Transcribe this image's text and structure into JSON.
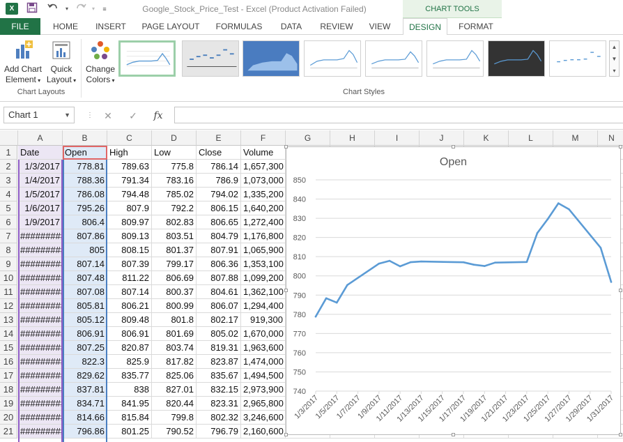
{
  "window": {
    "title": "Google_Stock_Price_Test - Excel (Product Activation Failed)",
    "app_icon": "X",
    "contextual_band": "CHART TOOLS"
  },
  "tabs": [
    "FILE",
    "HOME",
    "INSERT",
    "PAGE LAYOUT",
    "FORMULAS",
    "DATA",
    "REVIEW",
    "VIEW",
    "DESIGN",
    "FORMAT"
  ],
  "active_tab": "DESIGN",
  "ribbon": {
    "add_chart_line1": "Add Chart",
    "add_chart_line2": "Element",
    "quick_line1": "Quick",
    "quick_line2": "Layout",
    "change_line1": "Change",
    "change_line2": "Colors",
    "group_chart_layouts": "Chart Layouts",
    "group_chart_styles": "Chart Styles"
  },
  "formula_bar": {
    "name_box": "Chart 1",
    "cancel_icon": "✕",
    "enter_icon": "✓",
    "fx_label": "fx",
    "value": ""
  },
  "columns": [
    "A",
    "B",
    "C",
    "D",
    "E",
    "F",
    "G",
    "H",
    "I",
    "J",
    "K",
    "L",
    "M",
    "N"
  ],
  "rows": [
    [
      "Date",
      "Open",
      "High",
      "Low",
      "Close",
      "Volume"
    ],
    [
      "1/3/2017",
      "778.81",
      "789.63",
      "775.8",
      "786.14",
      "1,657,300"
    ],
    [
      "1/4/2017",
      "788.36",
      "791.34",
      "783.16",
      "786.9",
      "1,073,000"
    ],
    [
      "1/5/2017",
      "786.08",
      "794.48",
      "785.02",
      "794.02",
      "1,335,200"
    ],
    [
      "1/6/2017",
      "795.26",
      "807.9",
      "792.2",
      "806.15",
      "1,640,200"
    ],
    [
      "1/9/2017",
      "806.4",
      "809.97",
      "802.83",
      "806.65",
      "1,272,400"
    ],
    [
      "#########",
      "807.86",
      "809.13",
      "803.51",
      "804.79",
      "1,176,800"
    ],
    [
      "#########",
      "805",
      "808.15",
      "801.37",
      "807.91",
      "1,065,900"
    ],
    [
      "#########",
      "807.14",
      "807.39",
      "799.17",
      "806.36",
      "1,353,100"
    ],
    [
      "#########",
      "807.48",
      "811.22",
      "806.69",
      "807.88",
      "1,099,200"
    ],
    [
      "#########",
      "807.08",
      "807.14",
      "800.37",
      "804.61",
      "1,362,100"
    ],
    [
      "#########",
      "805.81",
      "806.21",
      "800.99",
      "806.07",
      "1,294,400"
    ],
    [
      "#########",
      "805.12",
      "809.48",
      "801.8",
      "802.17",
      "919,300"
    ],
    [
      "#########",
      "806.91",
      "806.91",
      "801.69",
      "805.02",
      "1,670,000"
    ],
    [
      "#########",
      "807.25",
      "820.87",
      "803.74",
      "819.31",
      "1,963,600"
    ],
    [
      "#########",
      "822.3",
      "825.9",
      "817.82",
      "823.87",
      "1,474,000"
    ],
    [
      "#########",
      "829.62",
      "835.77",
      "825.06",
      "835.67",
      "1,494,500"
    ],
    [
      "#########",
      "837.81",
      "838",
      "827.01",
      "832.15",
      "2,973,900"
    ],
    [
      "#########",
      "834.71",
      "841.95",
      "820.44",
      "823.31",
      "2,965,800"
    ],
    [
      "#########",
      "814.66",
      "815.84",
      "799.8",
      "802.32",
      "3,246,600"
    ],
    [
      "#########",
      "796.86",
      "801.25",
      "790.52",
      "796.79",
      "2,160,600"
    ]
  ],
  "colors": {
    "excel_green": "#217346",
    "series_blue": "#5b9bd5",
    "col_a_highlight": "#ece6f4",
    "col_b_highlight": "#dfeaf7"
  },
  "chart_data": {
    "type": "line",
    "title": "Open",
    "xlabel": "",
    "ylabel": "",
    "ylim": [
      740,
      850
    ],
    "yticks": [
      740,
      750,
      760,
      770,
      780,
      790,
      800,
      810,
      820,
      830,
      840,
      850
    ],
    "x_tick_labels": [
      "1/3/2017",
      "1/5/2017",
      "1/7/2017",
      "1/9/2017",
      "1/11/2017",
      "1/13/2017",
      "1/15/2017",
      "1/17/2017",
      "1/19/2017",
      "1/21/2017",
      "1/23/2017",
      "1/25/2017",
      "1/27/2017",
      "1/29/2017",
      "1/31/2017"
    ],
    "x_range": [
      "1/3/2017",
      "1/31/2017"
    ],
    "grid": true,
    "legend": "none",
    "series": [
      {
        "x": [
          "1/3/2017",
          "1/4/2017",
          "1/5/2017",
          "1/6/2017",
          "1/9/2017",
          "1/10/2017",
          "1/11/2017",
          "1/12/2017",
          "1/13/2017",
          "1/17/2017",
          "1/18/2017",
          "1/19/2017",
          "1/20/2017",
          "1/23/2017",
          "1/24/2017",
          "1/25/2017",
          "1/26/2017",
          "1/27/2017",
          "1/30/2017",
          "1/31/2017"
        ],
        "values": [
          778.81,
          788.36,
          786.08,
          795.26,
          806.4,
          807.86,
          805,
          807.14,
          807.48,
          807.08,
          805.81,
          805.12,
          806.91,
          807.25,
          822.3,
          829.62,
          837.81,
          834.71,
          814.66,
          796.86
        ]
      }
    ]
  }
}
